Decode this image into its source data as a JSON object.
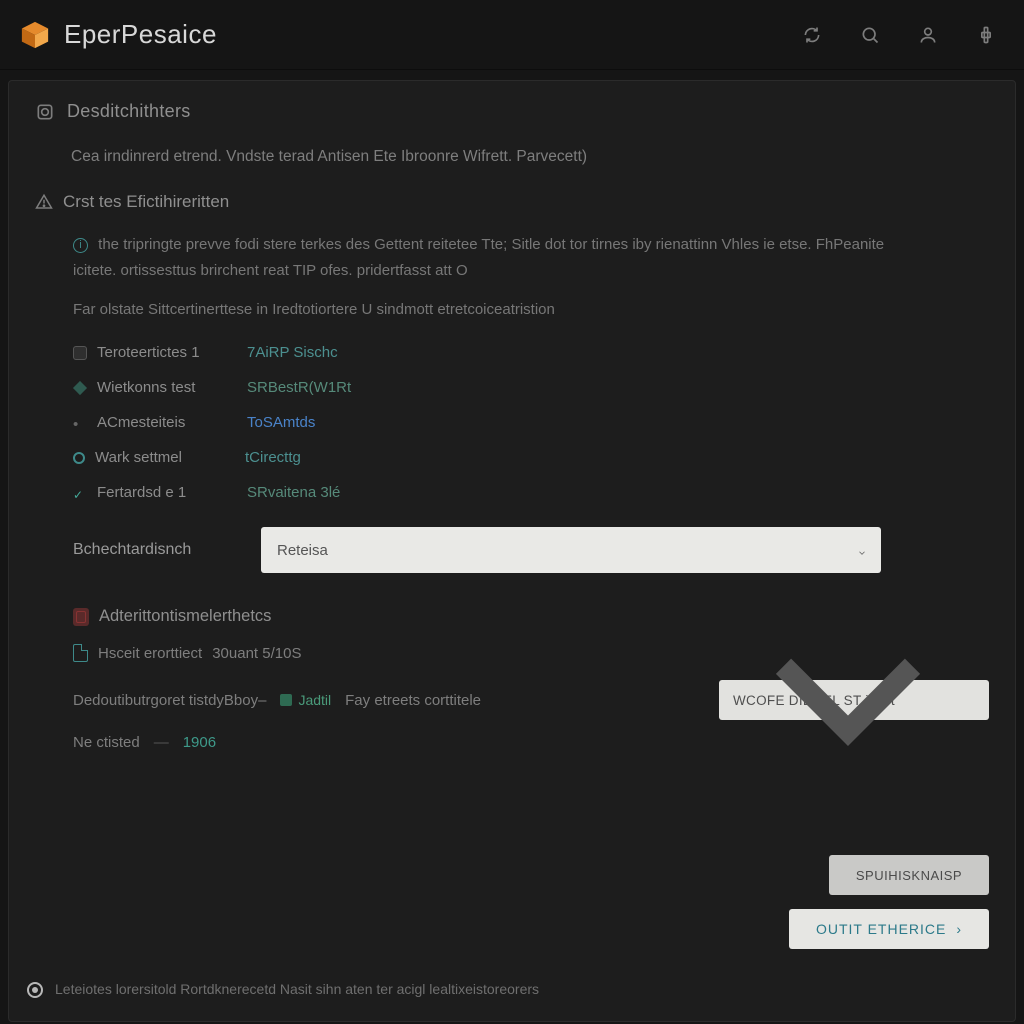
{
  "header": {
    "app_title": "EperPesaice"
  },
  "panel": {
    "section_title": "Desditchithters",
    "description": "Cea irndinrerd etrend. Vndste terad Antisen Ete Ibroonre Wifrett. Parvecett)",
    "subsection_title": "Crst tes Efictihireritten",
    "paragraph_main": "the tripringte prevve fodi stere terkes des Gettent reitetee Tte; Sitle dot tor tirnes iby rienattinn Vhles ie etse. FhPeanite icitete. ortissesttus brirchent reat TIP ofes. pridertfasst att O",
    "paragraph_secondary": "Far olstate Sittcertinerttese in Iredtotiortere U sindmott etretcoiceatristion",
    "kv": [
      {
        "label": "Teroteertictes 1",
        "value": "7AiRP Sischc"
      },
      {
        "label": "Wietkonns test",
        "value": "SRBestR(W1Rt"
      },
      {
        "label": "ACmesteiteis",
        "value": "ToSAmtds"
      },
      {
        "label": "Wark settmel",
        "value": "tCirecttg"
      },
      {
        "label": "Fertardsd e 1",
        "value": "SRvaitena 3lé"
      }
    ],
    "select": {
      "label": "Bchechtardisnch",
      "value": "Reteisa"
    },
    "lower": {
      "title": "Adterittontismelerthetcs",
      "line1_label": "Hsceit erorttiect",
      "line1_value": "30uant 5/10S",
      "triple": {
        "left": "Dedoutibutrgoret tistdyBboy–",
        "chip": "Jadtil",
        "mid": "Fay etreets corttitele",
        "dd_value": "WCOFE DIEGEL ST ictiot"
      },
      "ne_label": "Ne ctisted",
      "ne_value": "1906"
    },
    "buttons": {
      "secondary": "SPUIHISKNAISP",
      "primary": "OUTIT ETHERICE"
    },
    "footer_text": "Leteiotes lorersitold Rortdknerecetd\nNasit sihn aten ter acigl lealtixeistoreorers"
  }
}
